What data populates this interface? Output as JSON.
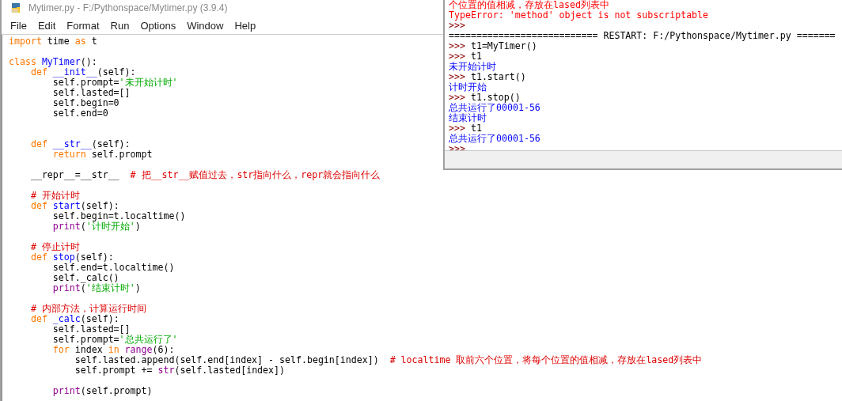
{
  "editor": {
    "title": "Mytimer.py - F:/Pythonspace/Mytimer.py (3.9.4)",
    "menu": [
      "File",
      "Edit",
      "Format",
      "Run",
      "Options",
      "Window",
      "Help"
    ],
    "lines": [
      {
        "kind": "code",
        "segments": [
          {
            "kind": "keyword",
            "text": "import"
          },
          {
            "kind": "plain",
            "text": " time "
          },
          {
            "kind": "keyword",
            "text": "as"
          },
          {
            "kind": "plain",
            "text": " t"
          }
        ]
      },
      {
        "kind": "blank"
      },
      {
        "kind": "code",
        "segments": [
          {
            "kind": "keyword",
            "text": "class"
          },
          {
            "kind": "name",
            "text": " MyTimer"
          },
          {
            "kind": "plain",
            "text": "():"
          }
        ]
      },
      {
        "kind": "code",
        "segments": [
          {
            "kind": "keyword",
            "text": "    def"
          },
          {
            "kind": "name",
            "text": " __init__"
          },
          {
            "kind": "plain",
            "text": "(self):"
          }
        ]
      },
      {
        "kind": "code",
        "segments": [
          {
            "kind": "plain",
            "text": "        self.prompt="
          },
          {
            "kind": "string",
            "text": "'未开始计时'"
          }
        ]
      },
      {
        "kind": "code",
        "segments": [
          {
            "kind": "plain",
            "text": "        self.lasted=[]"
          }
        ]
      },
      {
        "kind": "code",
        "segments": [
          {
            "kind": "plain",
            "text": "        self.begin=0"
          }
        ]
      },
      {
        "kind": "code",
        "segments": [
          {
            "kind": "plain",
            "text": "        self.end=0"
          }
        ]
      },
      {
        "kind": "blank"
      },
      {
        "kind": "blank"
      },
      {
        "kind": "code",
        "segments": [
          {
            "kind": "keyword",
            "text": "    def"
          },
          {
            "kind": "name",
            "text": " __str__"
          },
          {
            "kind": "plain",
            "text": "(self):"
          }
        ]
      },
      {
        "kind": "code",
        "segments": [
          {
            "kind": "keyword",
            "text": "        return"
          },
          {
            "kind": "plain",
            "text": " self.prompt"
          }
        ]
      },
      {
        "kind": "blank"
      },
      {
        "kind": "code",
        "segments": [
          {
            "kind": "plain",
            "text": "    __repr__=__str__"
          },
          {
            "kind": "comment",
            "text": "  # 把__str__赋值过去，str指向什么，repr就会指向什么"
          }
        ]
      },
      {
        "kind": "blank"
      },
      {
        "kind": "code",
        "segments": [
          {
            "kind": "comment",
            "text": "    # 开始计时"
          }
        ]
      },
      {
        "kind": "code",
        "segments": [
          {
            "kind": "keyword",
            "text": "    def"
          },
          {
            "kind": "name",
            "text": " start"
          },
          {
            "kind": "plain",
            "text": "(self):"
          }
        ]
      },
      {
        "kind": "code",
        "segments": [
          {
            "kind": "plain",
            "text": "        self.begin=t.localtime()"
          }
        ]
      },
      {
        "kind": "code",
        "segments": [
          {
            "kind": "builtin",
            "text": "        print"
          },
          {
            "kind": "plain",
            "text": "("
          },
          {
            "kind": "string",
            "text": "'计时开始'"
          },
          {
            "kind": "plain",
            "text": ")"
          }
        ]
      },
      {
        "kind": "blank"
      },
      {
        "kind": "code",
        "segments": [
          {
            "kind": "comment",
            "text": "    # 停止计时"
          }
        ]
      },
      {
        "kind": "code",
        "segments": [
          {
            "kind": "keyword",
            "text": "    def"
          },
          {
            "kind": "name",
            "text": " stop"
          },
          {
            "kind": "plain",
            "text": "(self):"
          }
        ]
      },
      {
        "kind": "code",
        "segments": [
          {
            "kind": "plain",
            "text": "        self.end=t.localtime()"
          }
        ]
      },
      {
        "kind": "code",
        "segments": [
          {
            "kind": "plain",
            "text": "        self._calc()"
          }
        ]
      },
      {
        "kind": "code",
        "segments": [
          {
            "kind": "builtin",
            "text": "        print"
          },
          {
            "kind": "plain",
            "text": "("
          },
          {
            "kind": "string",
            "text": "'结束计时'"
          },
          {
            "kind": "plain",
            "text": ")"
          }
        ]
      },
      {
        "kind": "blank"
      },
      {
        "kind": "code",
        "segments": [
          {
            "kind": "comment",
            "text": "    # 内部方法，计算运行时间"
          }
        ]
      },
      {
        "kind": "code",
        "segments": [
          {
            "kind": "keyword",
            "text": "    def"
          },
          {
            "kind": "name",
            "text": " _calc"
          },
          {
            "kind": "plain",
            "text": "(self):"
          }
        ]
      },
      {
        "kind": "code",
        "segments": [
          {
            "kind": "plain",
            "text": "        self.lasted=[]"
          }
        ]
      },
      {
        "kind": "code",
        "segments": [
          {
            "kind": "plain",
            "text": "        self.prompt="
          },
          {
            "kind": "string",
            "text": "'总共运行了'"
          }
        ]
      },
      {
        "kind": "code",
        "segments": [
          {
            "kind": "keyword",
            "text": "        for"
          },
          {
            "kind": "plain",
            "text": " index"
          },
          {
            "kind": "keyword",
            "text": " in"
          },
          {
            "kind": "builtin",
            "text": " range"
          },
          {
            "kind": "plain",
            "text": "(6):"
          }
        ]
      },
      {
        "kind": "code",
        "segments": [
          {
            "kind": "plain",
            "text": "            self.lasted.append(self.end[index] - self.begin[index])"
          },
          {
            "kind": "comment",
            "text": "  # localtime 取前六个位置，将每个位置的值相减，存放在lased列表中"
          }
        ]
      },
      {
        "kind": "code",
        "segments": [
          {
            "kind": "plain",
            "text": "            self.prompt += "
          },
          {
            "kind": "builtin",
            "text": "str"
          },
          {
            "kind": "plain",
            "text": "(self.lasted[index])"
          }
        ]
      },
      {
        "kind": "blank"
      },
      {
        "kind": "code",
        "segments": [
          {
            "kind": "builtin",
            "text": "        print"
          },
          {
            "kind": "plain",
            "text": "(self.prompt)"
          }
        ]
      }
    ]
  },
  "shell": {
    "lines": [
      {
        "segments": [
          {
            "kind": "error",
            "text": "个位置的值相减，存放在lased列表中"
          }
        ]
      },
      {
        "segments": [
          {
            "kind": "error",
            "text": "TypeError: 'method' object is not subscriptable"
          }
        ]
      },
      {
        "segments": [
          {
            "kind": "prompt",
            "text": ">>>"
          }
        ]
      },
      {
        "segments": [
          {
            "kind": "plain",
            "text": "=========================== RESTART: F:/Pythonspace/Mytimer.py ======="
          }
        ]
      },
      {
        "segments": [
          {
            "kind": "prompt",
            "text": ">>>"
          },
          {
            "kind": "plain",
            "text": " t1=MyTimer()"
          }
        ]
      },
      {
        "segments": [
          {
            "kind": "prompt",
            "text": ">>>"
          },
          {
            "kind": "plain",
            "text": " t1"
          }
        ]
      },
      {
        "segments": [
          {
            "kind": "output",
            "text": "未开始计时"
          }
        ]
      },
      {
        "segments": [
          {
            "kind": "prompt",
            "text": ">>>"
          },
          {
            "kind": "plain",
            "text": " t1.start()"
          }
        ]
      },
      {
        "segments": [
          {
            "kind": "output",
            "text": "计时开始"
          }
        ]
      },
      {
        "segments": [
          {
            "kind": "prompt",
            "text": ">>>"
          },
          {
            "kind": "plain",
            "text": " t1.stop()"
          }
        ]
      },
      {
        "segments": [
          {
            "kind": "output",
            "text": "总共运行了00001-56"
          }
        ]
      },
      {
        "segments": [
          {
            "kind": "output",
            "text": "结束计时"
          }
        ]
      },
      {
        "segments": [
          {
            "kind": "prompt",
            "text": ">>>"
          },
          {
            "kind": "plain",
            "text": " t1"
          }
        ]
      },
      {
        "segments": [
          {
            "kind": "output",
            "text": "总共运行了00001-56"
          }
        ]
      },
      {
        "segments": [
          {
            "kind": "prompt",
            "text": ">>>"
          }
        ]
      }
    ]
  }
}
